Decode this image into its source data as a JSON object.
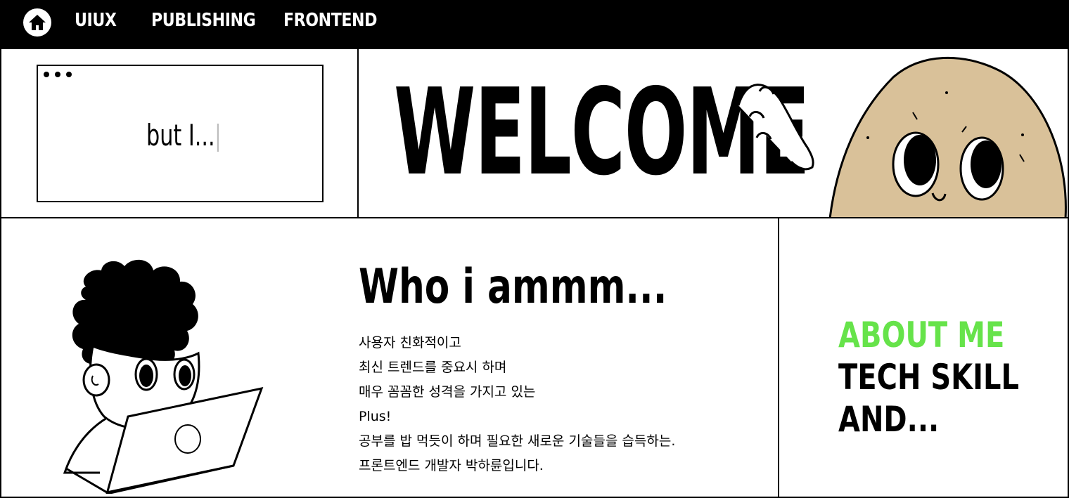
{
  "nav": {
    "home_icon": "home-icon",
    "links": [
      "UIUX",
      "PUBLISHING",
      "FRONTEND"
    ]
  },
  "terminal": {
    "typed_text": "but I..."
  },
  "hero": {
    "title": "WELCOME"
  },
  "about": {
    "title": "Who i ammm...",
    "lines": [
      "사용자 친화적이고",
      "최신 트렌드를 중요시 하며",
      "매우 꼼꼼한 성격을 가지고 있는",
      "Plus!",
      "공부를 밥 먹듯이 하며 필요한 새로운 기술들을 습득하는.",
      "프론트엔드 개발자 박하륜입니다."
    ]
  },
  "menu": {
    "items": [
      "ABOUT ME",
      "TECH SKILL",
      "AND..."
    ],
    "active_color": "#66e34a"
  },
  "colors": {
    "nav_bg": "#000000",
    "potato": "#d9c199",
    "accent": "#66e34a"
  }
}
